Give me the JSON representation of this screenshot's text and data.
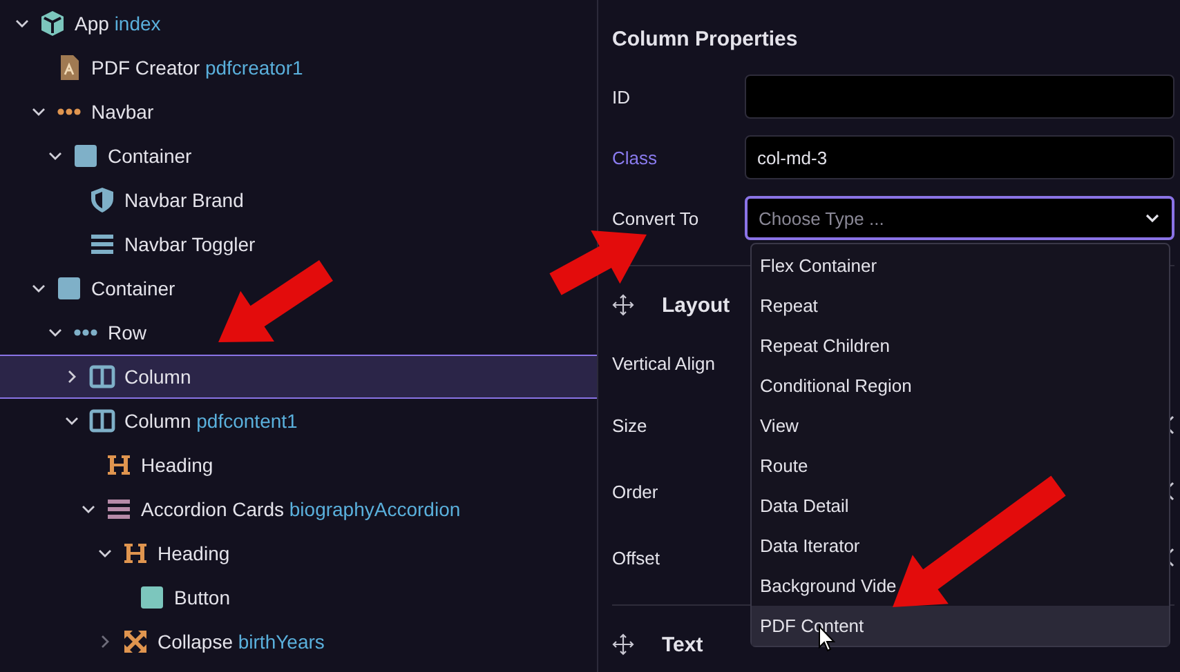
{
  "tree": [
    {
      "label": "App",
      "ident": "index",
      "kind": "cube",
      "expanded": true,
      "selected": false,
      "children": [
        {
          "label": "PDF Creator",
          "ident": "pdfcreator1",
          "kind": "pdf",
          "selected": false
        },
        {
          "label": "Navbar",
          "kind": "dots-orange",
          "expanded": true,
          "selected": false,
          "children": [
            {
              "label": "Container",
              "kind": "square-blue",
              "expanded": true,
              "selected": false,
              "children": [
                {
                  "label": "Navbar Brand",
                  "kind": "shield",
                  "selected": false
                },
                {
                  "label": "Navbar Toggler",
                  "kind": "lines-blue",
                  "selected": false
                }
              ]
            }
          ]
        },
        {
          "label": "Container",
          "kind": "square-blue",
          "expanded": true,
          "selected": false,
          "children": [
            {
              "label": "Row",
              "kind": "dots-blue",
              "expanded": true,
              "selected": false,
              "children": [
                {
                  "label": "Column",
                  "kind": "columns",
                  "expanded": false,
                  "selected": true
                },
                {
                  "label": "Column",
                  "ident": "pdfcontent1",
                  "kind": "columns",
                  "expanded": true,
                  "selected": false,
                  "children": [
                    {
                      "label": "Heading",
                      "kind": "heading",
                      "selected": false
                    },
                    {
                      "label": "Accordion Cards",
                      "ident": "biographyAccordion",
                      "kind": "lines-pink",
                      "expanded": true,
                      "selected": false,
                      "children": [
                        {
                          "label": "Heading",
                          "kind": "heading",
                          "expanded": true,
                          "selected": false,
                          "children": [
                            {
                              "label": "Button",
                              "kind": "square-teal",
                              "selected": false
                            }
                          ]
                        },
                        {
                          "label": "Collapse",
                          "ident": "birthYears",
                          "kind": "collapse",
                          "expanded": false,
                          "selected": false
                        }
                      ]
                    }
                  ]
                }
              ]
            }
          ]
        }
      ]
    }
  ],
  "properties": {
    "title": "Column Properties",
    "fields": [
      {
        "label": "ID",
        "kind": "input",
        "modified": false
      },
      {
        "label": "Class",
        "kind": "input",
        "value": "col-md-3",
        "modified": true
      },
      {
        "label": "Convert To",
        "kind": "select",
        "placeholder": "Choose Type ...",
        "modified": false,
        "focused": true
      }
    ],
    "sections": [
      {
        "title": "Layout",
        "rows": [
          "Vertical Align",
          "Size",
          "Order",
          "Offset"
        ]
      },
      {
        "title": "Text"
      }
    ]
  },
  "dropdown": {
    "options": [
      {
        "label": "Flex Container",
        "selected": false
      },
      {
        "label": "Repeat",
        "selected": false
      },
      {
        "label": "Repeat Children",
        "selected": false
      },
      {
        "label": "Conditional Region",
        "selected": false
      },
      {
        "label": "View",
        "selected": false
      },
      {
        "label": "Route",
        "selected": false
      },
      {
        "label": "Data Detail",
        "selected": false
      },
      {
        "label": "Data Iterator",
        "selected": false
      },
      {
        "label": "Background Vide",
        "selected": false
      },
      {
        "label": "PDF Content",
        "selected": true
      }
    ]
  }
}
